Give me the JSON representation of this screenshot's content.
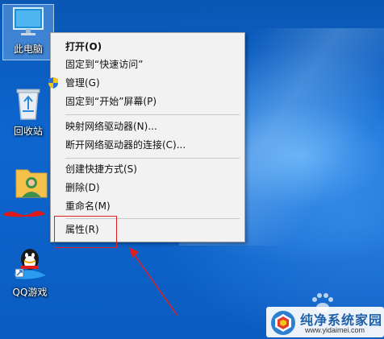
{
  "desktop": {
    "icons": [
      {
        "label": "此电脑",
        "icon": "computer-icon"
      },
      {
        "label": "回收站",
        "icon": "recycle-bin-icon"
      },
      {
        "label": "",
        "icon": "user-folder-icon"
      },
      {
        "label": "QQ游戏",
        "icon": "qq-game-icon"
      }
    ]
  },
  "context_menu": {
    "groups": [
      [
        {
          "label": "打开(O)",
          "bold": true
        },
        {
          "label": "固定到“快速访问”"
        },
        {
          "label": "管理(G)",
          "icon": "uac-shield-icon"
        },
        {
          "label": "固定到“开始”屏幕(P)"
        }
      ],
      [
        {
          "label": "映射网络驱动器(N)..."
        },
        {
          "label": "断开网络驱动器的连接(C)..."
        }
      ],
      [
        {
          "label": "创建快捷方式(S)"
        },
        {
          "label": "删除(D)"
        },
        {
          "label": "重命名(M)"
        }
      ],
      [
        {
          "label": "属性(R)",
          "highlighted": true
        }
      ]
    ]
  },
  "watermark": {
    "title": "纯净系统家园",
    "url": "www.yidaimei.com"
  },
  "colors": {
    "annotation": "#e02020",
    "menu_bg": "#f2f2f2",
    "desktop_blue": "#0b64c8"
  }
}
